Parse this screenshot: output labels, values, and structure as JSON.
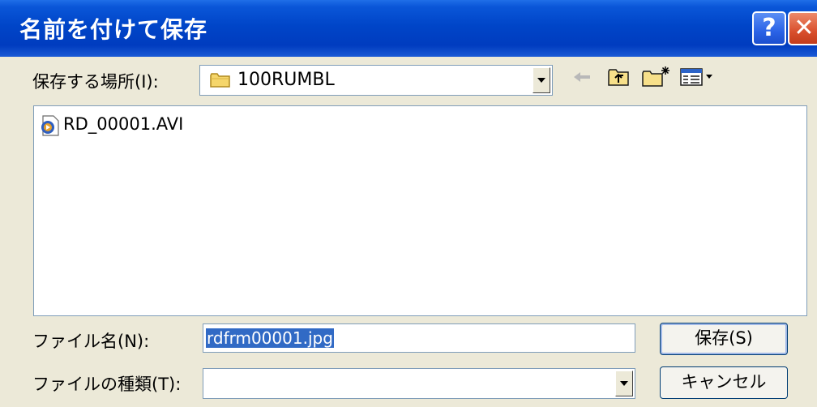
{
  "window": {
    "title": "名前を付けて保存",
    "help_label": "?",
    "close_label": "✕"
  },
  "save_in": {
    "label": "保存する場所(I):",
    "value": "100RUMBL"
  },
  "toolbar": {
    "icons": [
      "back-arrow-icon",
      "up-folder-icon",
      "new-folder-icon",
      "view-menu-icon"
    ]
  },
  "file_list": {
    "items": [
      {
        "name": "RD_00001.AVI",
        "icon": "video-file-icon"
      }
    ]
  },
  "filename": {
    "label": "ファイル名(N):",
    "value": "rdfrm00001.jpg"
  },
  "filetype": {
    "label": "ファイルの種類(T):",
    "value": ""
  },
  "buttons": {
    "save_label": "保存(S)",
    "cancel_label": "キャンセル"
  },
  "colors": {
    "titlebar": "#0a56d8",
    "selection": "#316ac5",
    "dialog_bg": "#ece9d8"
  }
}
